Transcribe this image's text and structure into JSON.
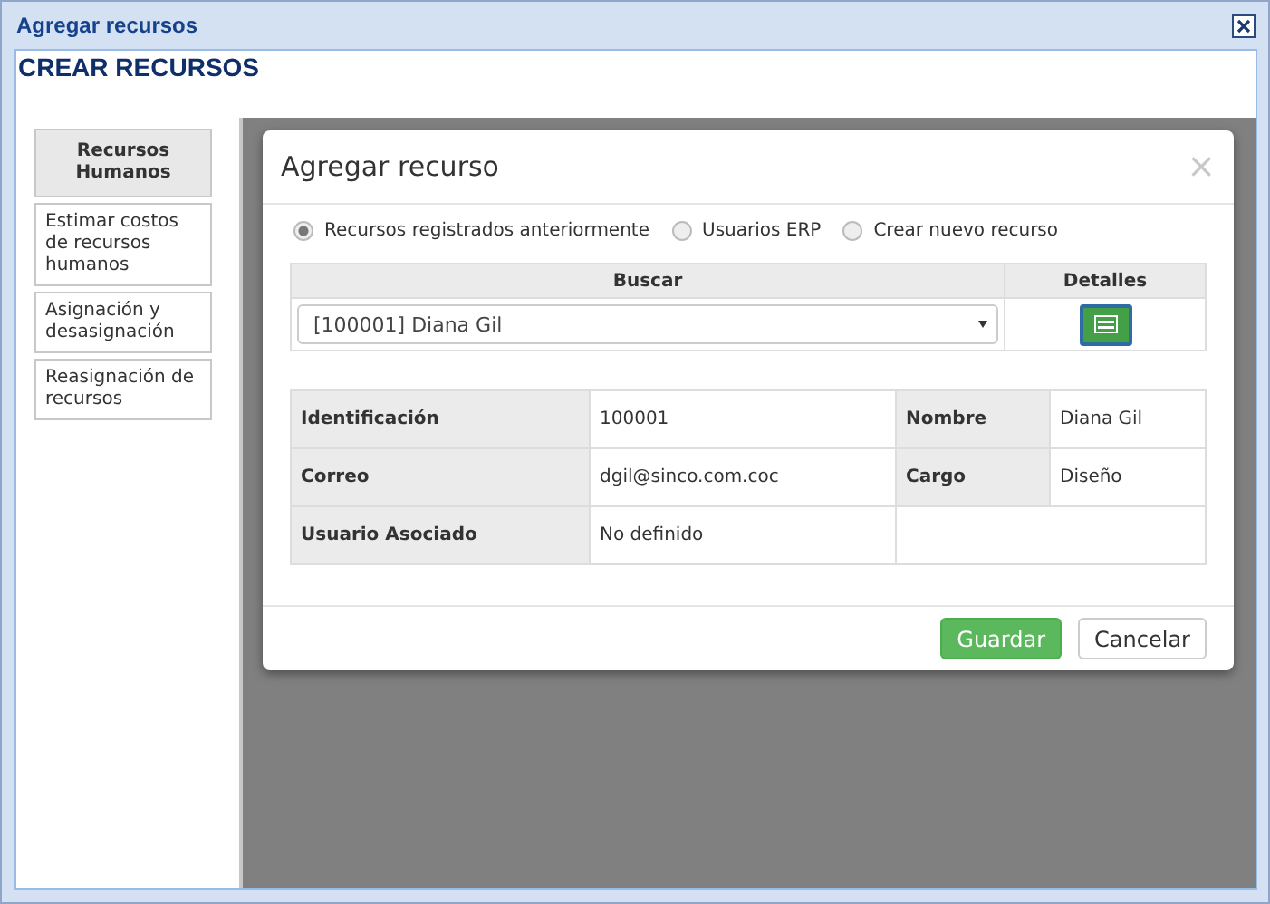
{
  "window": {
    "title": "Agregar recursos"
  },
  "page_title": "CREAR RECURSOS",
  "sidebar": {
    "items": [
      {
        "label": "Recursos Humanos",
        "selected": true
      },
      {
        "label": "Estimar costos de recursos humanos",
        "selected": false
      },
      {
        "label": "Asignación y desasignación",
        "selected": false
      },
      {
        "label": "Reasignación de recursos",
        "selected": false
      }
    ]
  },
  "dialog": {
    "title": "Agregar recurso",
    "close": "×",
    "options": [
      {
        "label": "Recursos registrados anteriormente",
        "selected": true
      },
      {
        "label": "Usuarios ERP",
        "selected": false
      },
      {
        "label": "Crear nuevo recurso",
        "selected": false
      }
    ],
    "search_table": {
      "columns": [
        "Buscar",
        "Detalles"
      ],
      "select_value": "[100001] Diana Gil"
    },
    "details": [
      [
        {
          "label": "Identificación",
          "value": "100001"
        },
        {
          "label": "Nombre",
          "value": "Diana Gil"
        }
      ],
      [
        {
          "label": "Correo",
          "value": "dgil@sinco.com.coc"
        },
        {
          "label": "Cargo",
          "value": "Diseño"
        }
      ],
      [
        {
          "label": "Usuario Asociado",
          "value": "No definido"
        }
      ]
    ],
    "buttons": [
      {
        "label": "Guardar",
        "kind": "primary"
      },
      {
        "label": "Cancelar",
        "kind": "default"
      }
    ]
  }
}
